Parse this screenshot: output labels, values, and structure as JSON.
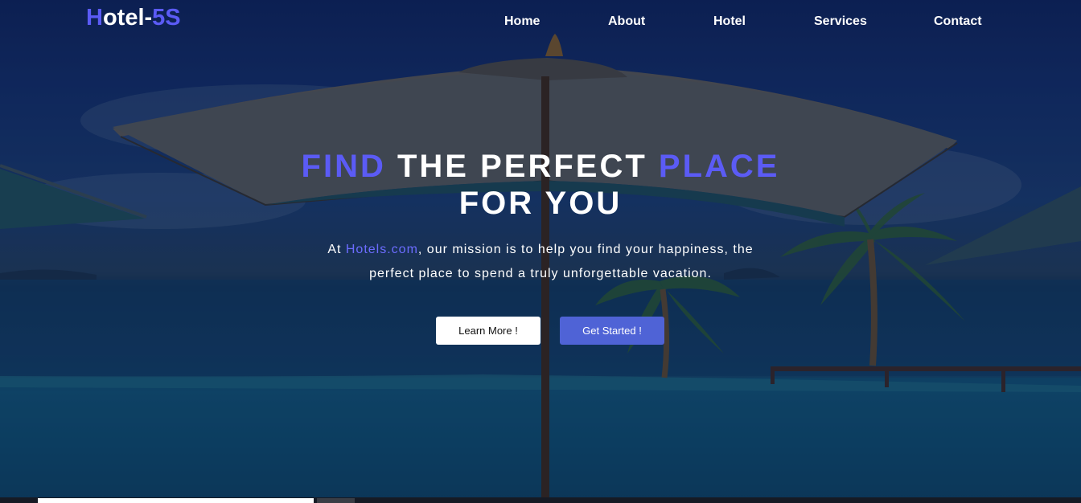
{
  "brand": {
    "first_letter": "H",
    "middle": "otel-",
    "suffix": "5S"
  },
  "nav": {
    "items": [
      "Home",
      "About",
      "Hotel",
      "Services",
      "Contact"
    ]
  },
  "hero": {
    "headline_word1": "FIND",
    "headline_word2": " THE PERFECT ",
    "headline_word3": "PLACE",
    "headline_line2": "FOR YOU",
    "tagline_prefix": "At ",
    "tagline_link": "Hotels.com",
    "tagline_line1_rest": ", our mission is to help you find your happiness, the",
    "tagline_line2": "perfect place to spend a truly unforgettable vacation.",
    "learn_more_label": "Learn More !",
    "get_started_label": "Get Started !"
  },
  "colors": {
    "accent": "#5b5bf5",
    "primary_button": "#4f63d6",
    "overlay": "#0b1a3a"
  }
}
